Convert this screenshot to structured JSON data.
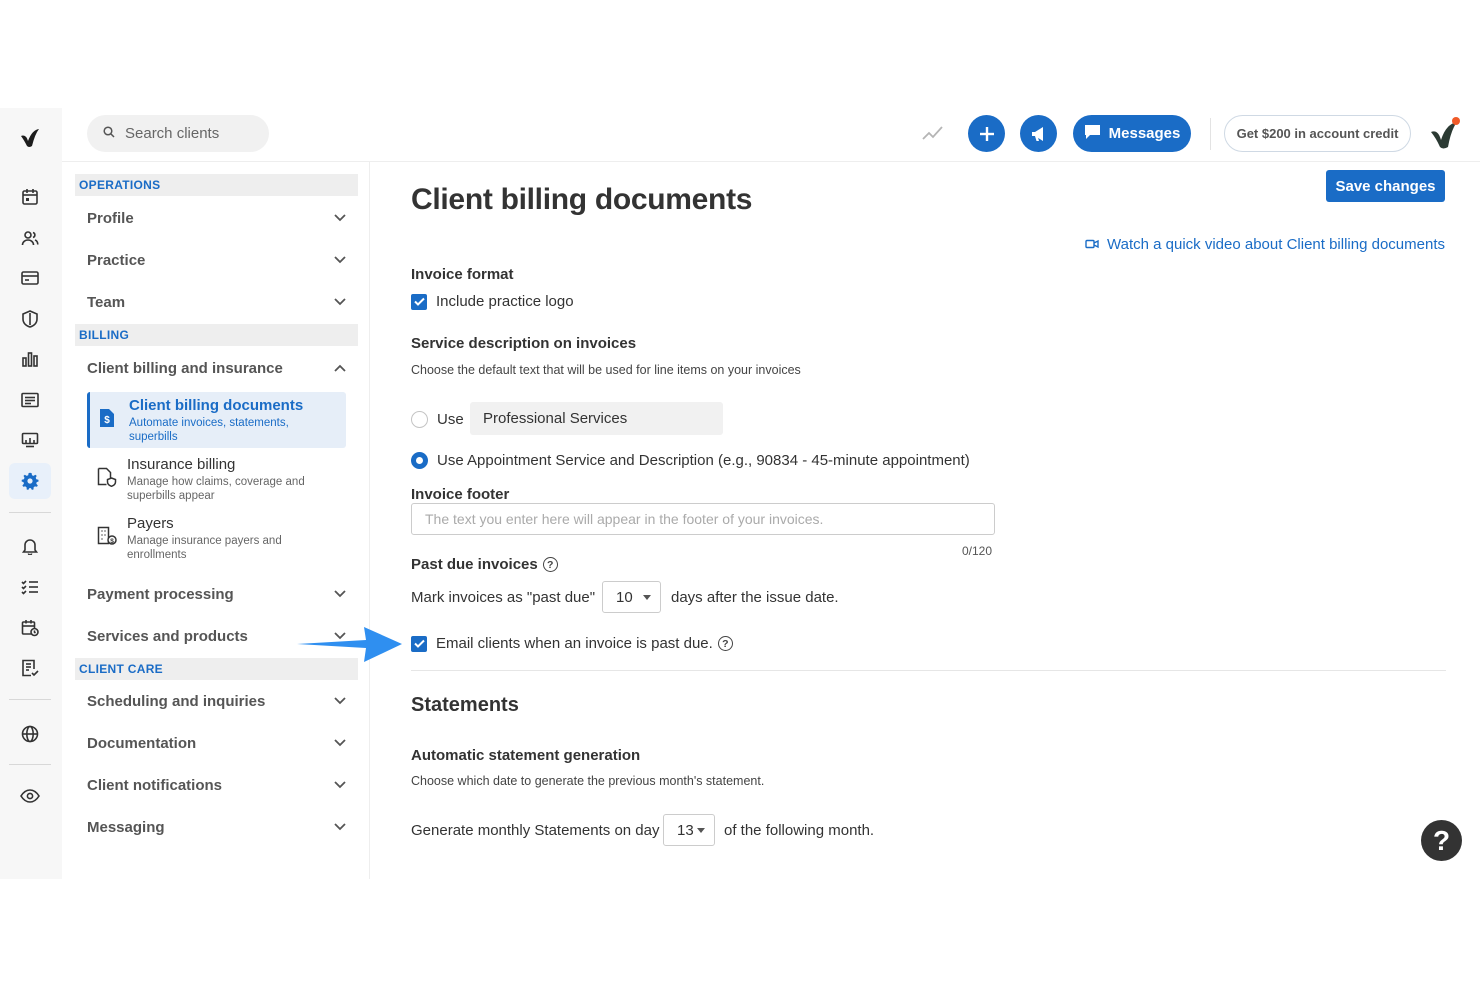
{
  "search": {
    "placeholder": "Search clients"
  },
  "topbar": {
    "messages_label": "Messages",
    "credit_label": "Get $200 in account credit"
  },
  "rail": {
    "icons": [
      "logo-icon",
      "calendar-icon",
      "clients-icon",
      "billing-card-icon",
      "insurance-shield-icon",
      "analytics-icon",
      "documents-icon",
      "marketplace-icon",
      "settings-gear-icon",
      "bell-icon",
      "tasks-icon",
      "calendar-clock-icon",
      "reports-icon",
      "globe-icon",
      "eye-icon"
    ],
    "active": "settings-gear-icon"
  },
  "nav": {
    "operations_head": "OPERATIONS",
    "profile": "Profile",
    "practice": "Practice",
    "team": "Team",
    "billing_head": "BILLING",
    "client_billing_insurance": "Client billing and insurance",
    "sub": [
      {
        "title": "Client billing documents",
        "desc": "Automate invoices, statements, superbills"
      },
      {
        "title": "Insurance billing",
        "desc": "Manage how claims, coverage and superbills appear"
      },
      {
        "title": "Payers",
        "desc": "Manage insurance payers and enrollments"
      }
    ],
    "payment_processing": "Payment processing",
    "services_products": "Services and products",
    "client_care_head": "CLIENT CARE",
    "scheduling": "Scheduling and inquiries",
    "documentation": "Documentation",
    "client_notifications": "Client notifications",
    "messaging": "Messaging"
  },
  "main": {
    "title": "Client billing documents",
    "save_label": "Save changes",
    "video_link": "Watch a quick video about Client billing documents",
    "invoice_format": "Invoice format",
    "include_logo": "Include practice logo",
    "service_desc_label": "Service description on invoices",
    "service_desc_help": "Choose the default text that will be used for line items on your invoices",
    "use_label": "Use",
    "service_value": "Professional Services",
    "use_appt_label": "Use Appointment Service and Description (e.g., 90834 - 45-minute appointment)",
    "invoice_footer": "Invoice footer",
    "footer_placeholder": "The text you enter here will appear in the footer of your invoices.",
    "footer_count": "0/120",
    "past_due_label": "Past due invoices",
    "mark_prefix": "Mark invoices as \"past due\"",
    "past_due_days": "10",
    "mark_suffix": "days after the issue date.",
    "email_past_due": "Email clients when an invoice is past due.",
    "statements_title": "Statements",
    "auto_statement_label": "Automatic statement generation",
    "auto_statement_help": "Choose which date to generate the previous month's statement.",
    "generate_prefix": "Generate monthly Statements on day",
    "statement_day": "13",
    "generate_suffix": "of the following month."
  },
  "help_fab": "?",
  "colors": {
    "accent": "#1a6cc6",
    "arrow": "#2f8ff0"
  }
}
